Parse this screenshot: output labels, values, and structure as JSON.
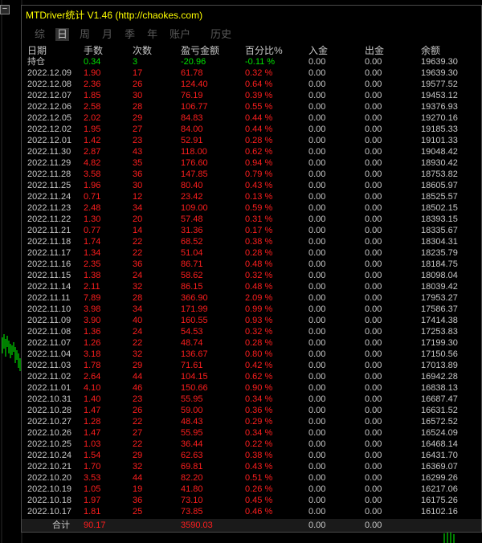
{
  "window": {
    "title": "MTDriver统计 V1.46  (http://chaokes.com)",
    "minimize_label": "−"
  },
  "tabs": [
    {
      "label": "综",
      "active": false
    },
    {
      "label": "日",
      "active": true
    },
    {
      "label": "周",
      "active": false
    },
    {
      "label": "月",
      "active": false
    },
    {
      "label": "季",
      "active": false
    },
    {
      "label": "年",
      "active": false
    },
    {
      "label": "账户",
      "active": false
    },
    {
      "label": "历史",
      "active": false
    }
  ],
  "columns": [
    "日期",
    "手数",
    "次数",
    "盈亏金额",
    "百分比%",
    "入金",
    "出金",
    "余额"
  ],
  "holding": [
    "持仓",
    "0.34",
    "3",
    "-20.96",
    "-0.11 %",
    "0.00",
    "0.00",
    "19639.30"
  ],
  "rows": [
    [
      "2022.12.09",
      "1.90",
      "17",
      "61.78",
      "0.32 %",
      "0.00",
      "0.00",
      "19639.30"
    ],
    [
      "2022.12.08",
      "2.36",
      "26",
      "124.40",
      "0.64 %",
      "0.00",
      "0.00",
      "19577.52"
    ],
    [
      "2022.12.07",
      "1.85",
      "30",
      "76.19",
      "0.39 %",
      "0.00",
      "0.00",
      "19453.12"
    ],
    [
      "2022.12.06",
      "2.58",
      "28",
      "106.77",
      "0.55 %",
      "0.00",
      "0.00",
      "19376.93"
    ],
    [
      "2022.12.05",
      "2.02",
      "29",
      "84.83",
      "0.44 %",
      "0.00",
      "0.00",
      "19270.16"
    ],
    [
      "2022.12.02",
      "1.95",
      "27",
      "84.00",
      "0.44 %",
      "0.00",
      "0.00",
      "19185.33"
    ],
    [
      "2022.12.01",
      "1.42",
      "23",
      "52.91",
      "0.28 %",
      "0.00",
      "0.00",
      "19101.33"
    ],
    [
      "2022.11.30",
      "2.87",
      "43",
      "118.00",
      "0.62 %",
      "0.00",
      "0.00",
      "19048.42"
    ],
    [
      "2022.11.29",
      "4.82",
      "35",
      "176.60",
      "0.94 %",
      "0.00",
      "0.00",
      "18930.42"
    ],
    [
      "2022.11.28",
      "3.58",
      "36",
      "147.85",
      "0.79 %",
      "0.00",
      "0.00",
      "18753.82"
    ],
    [
      "2022.11.25",
      "1.96",
      "30",
      "80.40",
      "0.43 %",
      "0.00",
      "0.00",
      "18605.97"
    ],
    [
      "2022.11.24",
      "0.71",
      "12",
      "23.42",
      "0.13 %",
      "0.00",
      "0.00",
      "18525.57"
    ],
    [
      "2022.11.23",
      "2.48",
      "34",
      "109.00",
      "0.59 %",
      "0.00",
      "0.00",
      "18502.15"
    ],
    [
      "2022.11.22",
      "1.30",
      "20",
      "57.48",
      "0.31 %",
      "0.00",
      "0.00",
      "18393.15"
    ],
    [
      "2022.11.21",
      "0.77",
      "14",
      "31.36",
      "0.17 %",
      "0.00",
      "0.00",
      "18335.67"
    ],
    [
      "2022.11.18",
      "1.74",
      "22",
      "68.52",
      "0.38 %",
      "0.00",
      "0.00",
      "18304.31"
    ],
    [
      "2022.11.17",
      "1.34",
      "22",
      "51.04",
      "0.28 %",
      "0.00",
      "0.00",
      "18235.79"
    ],
    [
      "2022.11.16",
      "2.35",
      "36",
      "86.71",
      "0.48 %",
      "0.00",
      "0.00",
      "18184.75"
    ],
    [
      "2022.11.15",
      "1.38",
      "24",
      "58.62",
      "0.32 %",
      "0.00",
      "0.00",
      "18098.04"
    ],
    [
      "2022.11.14",
      "2.11",
      "32",
      "86.15",
      "0.48 %",
      "0.00",
      "0.00",
      "18039.42"
    ],
    [
      "2022.11.11",
      "7.89",
      "28",
      "366.90",
      "2.09 %",
      "0.00",
      "0.00",
      "17953.27"
    ],
    [
      "2022.11.10",
      "3.98",
      "34",
      "171.99",
      "0.99 %",
      "0.00",
      "0.00",
      "17586.37"
    ],
    [
      "2022.11.09",
      "3.90",
      "40",
      "160.55",
      "0.93 %",
      "0.00",
      "0.00",
      "17414.38"
    ],
    [
      "2022.11.08",
      "1.36",
      "24",
      "54.53",
      "0.32 %",
      "0.00",
      "0.00",
      "17253.83"
    ],
    [
      "2022.11.07",
      "1.26",
      "22",
      "48.74",
      "0.28 %",
      "0.00",
      "0.00",
      "17199.30"
    ],
    [
      "2022.11.04",
      "3.18",
      "32",
      "136.67",
      "0.80 %",
      "0.00",
      "0.00",
      "17150.56"
    ],
    [
      "2022.11.03",
      "1.78",
      "29",
      "71.61",
      "0.42 %",
      "0.00",
      "0.00",
      "17013.89"
    ],
    [
      "2022.11.02",
      "2.64",
      "44",
      "104.15",
      "0.62 %",
      "0.00",
      "0.00",
      "16942.28"
    ],
    [
      "2022.11.01",
      "4.10",
      "46",
      "150.66",
      "0.90 %",
      "0.00",
      "0.00",
      "16838.13"
    ],
    [
      "2022.10.31",
      "1.40",
      "23",
      "55.95",
      "0.34 %",
      "0.00",
      "0.00",
      "16687.47"
    ],
    [
      "2022.10.28",
      "1.47",
      "26",
      "59.00",
      "0.36 %",
      "0.00",
      "0.00",
      "16631.52"
    ],
    [
      "2022.10.27",
      "1.28",
      "22",
      "48.43",
      "0.29 %",
      "0.00",
      "0.00",
      "16572.52"
    ],
    [
      "2022.10.26",
      "1.47",
      "27",
      "55.95",
      "0.34 %",
      "0.00",
      "0.00",
      "16524.09"
    ],
    [
      "2022.10.25",
      "1.03",
      "22",
      "36.44",
      "0.22 %",
      "0.00",
      "0.00",
      "16468.14"
    ],
    [
      "2022.10.24",
      "1.54",
      "29",
      "62.63",
      "0.38 %",
      "0.00",
      "0.00",
      "16431.70"
    ],
    [
      "2022.10.21",
      "1.70",
      "32",
      "69.81",
      "0.43 %",
      "0.00",
      "0.00",
      "16369.07"
    ],
    [
      "2022.10.20",
      "3.53",
      "44",
      "82.20",
      "0.51 %",
      "0.00",
      "0.00",
      "16299.26"
    ],
    [
      "2022.10.19",
      "1.05",
      "19",
      "41.80",
      "0.26 %",
      "0.00",
      "0.00",
      "16217.06"
    ],
    [
      "2022.10.18",
      "1.97",
      "36",
      "73.10",
      "0.45 %",
      "0.00",
      "0.00",
      "16175.26"
    ],
    [
      "2022.10.17",
      "1.81",
      "25",
      "73.85",
      "0.46 %",
      "0.00",
      "0.00",
      "16102.16"
    ]
  ],
  "totals": [
    "合计",
    "90.17",
    "",
    "3590.03",
    "",
    "0.00",
    "0.00",
    ""
  ],
  "colors": {
    "title": "#ffff00",
    "profit": "#ff1e1e",
    "holding": "#00e000",
    "text": "#c8c8c8"
  }
}
